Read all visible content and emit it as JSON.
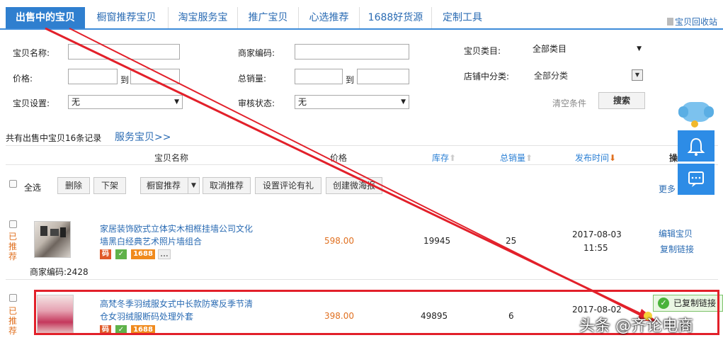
{
  "tabs": [
    {
      "label": "出售中的宝贝"
    },
    {
      "label": "橱窗推荐宝贝"
    },
    {
      "label": "淘宝服务宝"
    },
    {
      "label": "推广宝贝"
    },
    {
      "label": "心选推荐"
    },
    {
      "label": "1688好货源"
    },
    {
      "label": "定制工具"
    }
  ],
  "recycle_label": "宝贝回收站",
  "filters": {
    "name_label": "宝贝名称:",
    "code_label": "商家编码:",
    "category_label": "宝贝类目:",
    "category_value": "全部类目",
    "price_label": "价格:",
    "to1": "到",
    "sales_label": "总销量:",
    "to2": "到",
    "shopcat_label": "店铺中分类:",
    "shopcat_value": "全部分类",
    "setting_label": "宝贝设置:",
    "setting_value": "无",
    "audit_label": "审核状态:",
    "audit_value": "无",
    "clear_label": "清空条件",
    "search_label": "搜索"
  },
  "summary": {
    "text": "共有出售中宝贝16条记录",
    "service_link": "服务宝贝>>"
  },
  "table_headers": {
    "name": "宝贝名称",
    "price": "价格",
    "stock": "库存",
    "sales": "总销量",
    "time": "发布时间",
    "ops": "操"
  },
  "actions": {
    "select_all": "全选",
    "delete": "删除",
    "offshelf": "下架",
    "recommend": "橱窗推荐",
    "cancel_recommend": "取消推荐",
    "set_review": "设置评论有礼",
    "create_wei": "创建微海报",
    "more": "更多"
  },
  "rows": [
    {
      "status": "已推荐",
      "title_line1": "家居装饰欧式立体实木相框挂墙公司文化",
      "title_line2": "墙黑白经典艺术照片墙组合",
      "code_text": "商家编码:2428",
      "price": "598.00",
      "stock": "19945",
      "sales": "25",
      "date": "2017-08-03",
      "time": "11:55",
      "op1": "编辑宝贝",
      "op2": "复制链接",
      "badge_code": "码",
      "badge_1688": "1688",
      "badge_more": "..."
    },
    {
      "status": "已推荐",
      "title_line1": "高梵冬季羽绒服女式中长款防寒反季节清",
      "title_line2": "仓女羽绒服断码处理外套",
      "price": "398.00",
      "stock": "49895",
      "sales": "6",
      "date": "2017-08-02",
      "badge_code": "码",
      "badge_1688": "1688"
    }
  ],
  "copied_toast": "已复制链接",
  "watermark": "头条 @齐论电商",
  "colors": {
    "primary": "#2f7fcf",
    "link": "#2a6bb3",
    "price": "#e07020",
    "annotation": "#e2202a"
  }
}
